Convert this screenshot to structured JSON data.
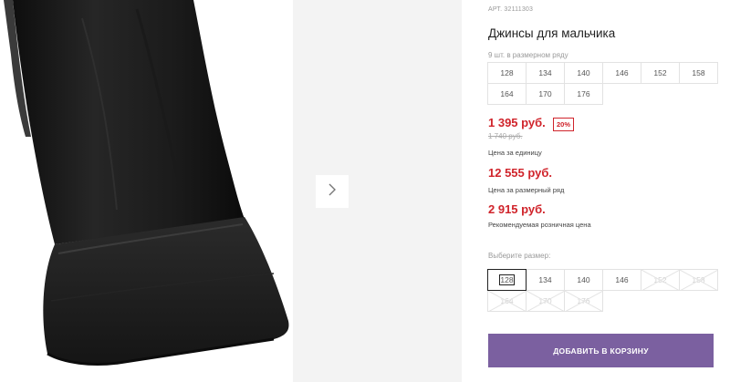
{
  "product": {
    "sku": "АРТ. 32111303",
    "title": "Джинсы для мальчика",
    "image_alt": "jeans-cuff-photo"
  },
  "gallery": {
    "next_icon": "chevron-right-icon"
  },
  "pack": {
    "note": "9 шт. в размерном ряду",
    "sizes": [
      "128",
      "134",
      "140",
      "146",
      "152",
      "158",
      "164",
      "170",
      "176"
    ]
  },
  "prices": {
    "unit_price": "1 395 руб.",
    "discount": "20%",
    "old_price": "1 740 руб.",
    "unit_label": "Цена за единицу",
    "pack_price": "12 555 руб.",
    "pack_label": "Цена за размерный ряд",
    "retail_price": "2 915 руб.",
    "retail_label": "Рекомендуемая розничная цена",
    "accent_color": "#d0242b"
  },
  "size_select": {
    "label": "Выберите размер:",
    "options": [
      {
        "label": "128",
        "state": "selected"
      },
      {
        "label": "134",
        "state": "available"
      },
      {
        "label": "140",
        "state": "available"
      },
      {
        "label": "146",
        "state": "available"
      },
      {
        "label": "152",
        "state": "disabled"
      },
      {
        "label": "158",
        "state": "disabled"
      },
      {
        "label": "164",
        "state": "disabled"
      },
      {
        "label": "170",
        "state": "disabled"
      },
      {
        "label": "176",
        "state": "disabled"
      }
    ]
  },
  "cart": {
    "button_label": "ДОБАВИТЬ В КОРЗИНУ",
    "button_color": "#7b60a0"
  }
}
